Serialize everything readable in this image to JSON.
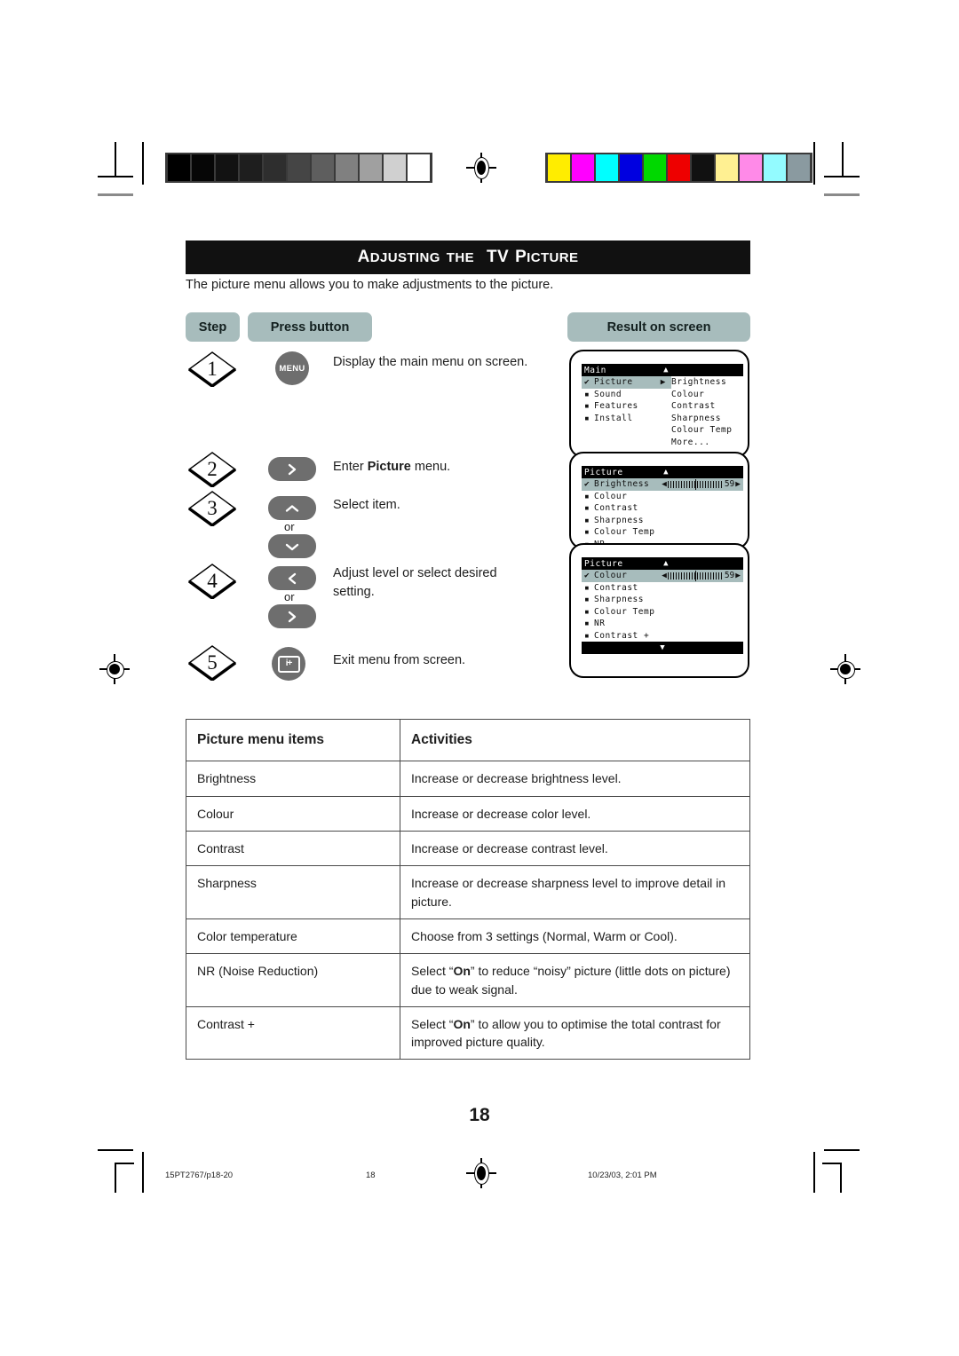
{
  "banner": {
    "word1_cap": "A",
    "word1_rest": "DJUSTING",
    "word2": "THE",
    "word3": "TV",
    "word4_cap": "P",
    "word4_rest": "ICTURE"
  },
  "intro": "The picture menu allows you to make adjustments to the picture.",
  "headers": {
    "step": "Step",
    "press_button": "Press button",
    "result_on_screen": "Result on screen"
  },
  "steps": [
    {
      "number": "1",
      "button": "MENU",
      "button_kind": "menu-round",
      "text": "Display the main menu on screen."
    },
    {
      "number": "2",
      "button": "›",
      "button_kind": "right",
      "text": "Enter Picture menu.",
      "bold_word": "Picture"
    },
    {
      "number": "3",
      "button": "˄",
      "button_kind": "up",
      "text": "Select item.",
      "or_label": "or",
      "button2_kind": "down"
    },
    {
      "number": "4",
      "button": "‹",
      "button_kind": "left",
      "text": "Adjust level or select desired setting.",
      "or_label": "or",
      "button2_kind": "right"
    },
    {
      "number": "5",
      "button": "i+",
      "button_kind": "info",
      "text": "Exit menu from screen."
    }
  ],
  "step_texts": {
    "s1": "Display the main menu on screen.",
    "s2_pre": "Enter ",
    "s2_bold": "Picture",
    "s2_post": " menu.",
    "s3": "Select item.",
    "s4_line1": "Adjust level or select desired",
    "s4_line2": "setting.",
    "s5": "Exit menu from screen.",
    "or": "or"
  },
  "osd": {
    "screen1": {
      "title": "Main",
      "up_arrow": "▲",
      "left_items": [
        {
          "mark": "✔",
          "label": "Picture",
          "highlight": true,
          "pointer": "▶"
        },
        {
          "mark": "▪",
          "label": "Sound",
          "highlight": false
        },
        {
          "mark": "▪",
          "label": "Features",
          "highlight": false
        },
        {
          "mark": "▪",
          "label": "Install",
          "highlight": false
        }
      ],
      "right_items": [
        "Brightness",
        "Colour",
        "Contrast",
        "Sharpness",
        "Colour Temp",
        "More..."
      ]
    },
    "screen2": {
      "title": "Picture",
      "up_arrow": "▲",
      "items": [
        {
          "mark": "✔",
          "label": "Brightness",
          "highlight": true,
          "slider": true,
          "value": "59"
        },
        {
          "mark": "▪",
          "label": "Colour",
          "highlight": false
        },
        {
          "mark": "▪",
          "label": "Contrast",
          "highlight": false
        },
        {
          "mark": "▪",
          "label": "Sharpness",
          "highlight": false
        },
        {
          "mark": "▪",
          "label": "Colour Temp",
          "highlight": false
        },
        {
          "mark": "▪",
          "label": "NR",
          "highlight": false
        }
      ]
    },
    "screen3": {
      "title": "Picture",
      "up_arrow": "▲",
      "down_arrow": "▼",
      "items": [
        {
          "mark": "✔",
          "label": "Colour",
          "highlight": true,
          "slider": true,
          "value": "59"
        },
        {
          "mark": "▪",
          "label": "Contrast",
          "highlight": false
        },
        {
          "mark": "▪",
          "label": "Sharpness",
          "highlight": false
        },
        {
          "mark": "▪",
          "label": "Colour Temp",
          "highlight": false
        },
        {
          "mark": "▪",
          "label": "NR",
          "highlight": false
        },
        {
          "mark": "▪",
          "label": "Contrast +",
          "highlight": false
        }
      ]
    },
    "slider_left_arrow": "◀",
    "slider_right_arrow": "▶"
  },
  "table": {
    "headers": [
      "Picture menu items",
      "Activities"
    ],
    "rows": [
      {
        "item": "Brightness",
        "activity": "Increase or decrease brightness level."
      },
      {
        "item": "Colour",
        "activity": "Increase or decrease color level."
      },
      {
        "item": "Contrast",
        "activity": "Increase or decrease contrast level."
      },
      {
        "item": "Sharpness",
        "activity": "Increase or decrease sharpness level to improve detail in picture."
      },
      {
        "item": "Color temperature",
        "activity": "Choose from 3 settings (Normal, Warm or Cool)."
      },
      {
        "item": "NR (Noise Reduction)",
        "activity_pre": "Select “",
        "activity_bold": "On",
        "activity_post": "” to reduce “noisy” picture (little dots on picture) due to weak signal."
      },
      {
        "item": "Contrast +",
        "activity_pre": "Select “",
        "activity_bold": "On",
        "activity_post": "” to allow you to optimise the total contrast for improved picture quality."
      }
    ]
  },
  "page_number": "18",
  "footer": {
    "file": "15PT2767/p18-20",
    "page": "18",
    "timestamp": "10/23/03, 2:01 PM"
  },
  "calibration": {
    "grayscale": [
      "#000000",
      "#060606",
      "#121212",
      "#1e1e1e",
      "#2e2e2e",
      "#454545",
      "#5e5e5e",
      "#808080",
      "#a0a0a0",
      "#d0d0d0",
      "#ffffff"
    ],
    "colors": [
      "#ffed00",
      "#ff00ff",
      "#00ffff",
      "#0000e0",
      "#00d800",
      "#ee0000",
      "#111111",
      "#fff092",
      "#ff8ae8",
      "#93fbff",
      "#8a9aa0"
    ]
  }
}
